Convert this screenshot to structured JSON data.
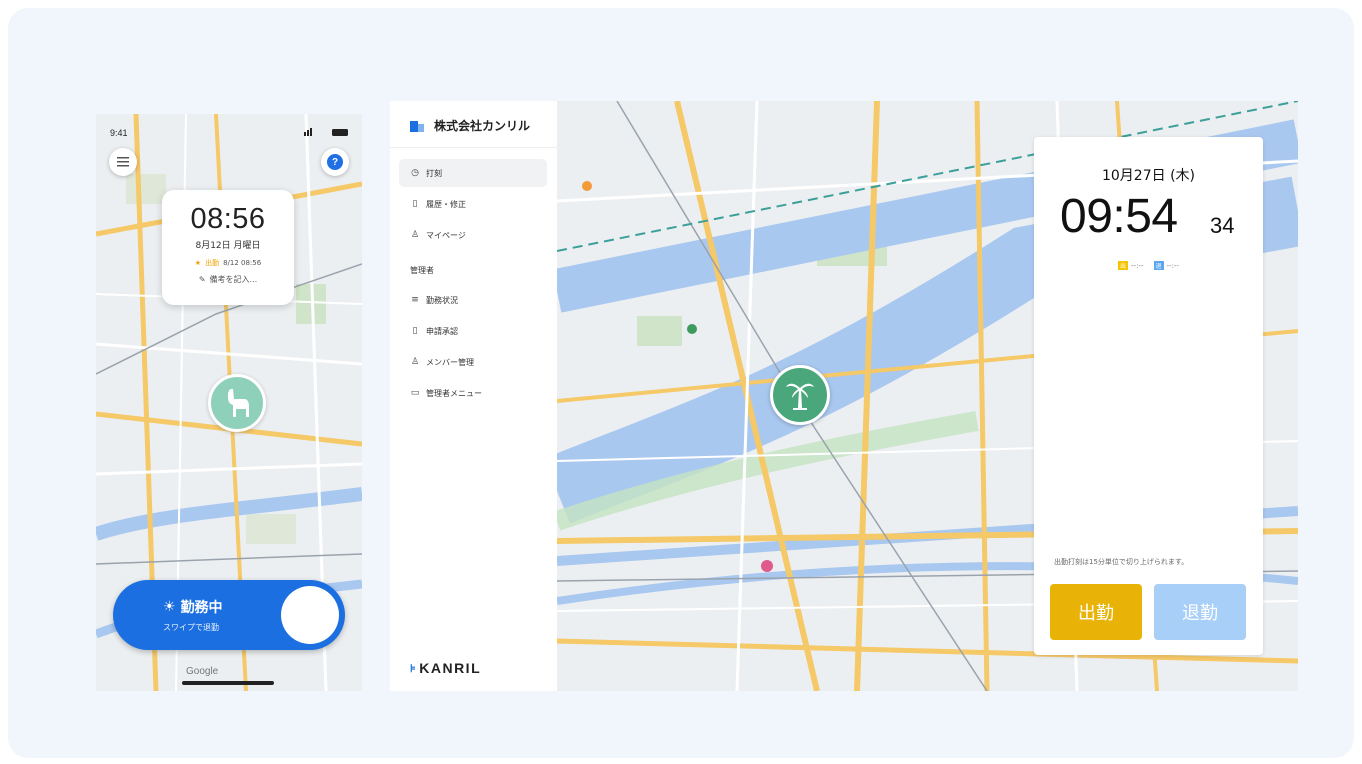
{
  "phone": {
    "status_time": "9:41",
    "clock": {
      "time": "08:56",
      "date": "8月12日 月曜日",
      "punch_label": "出勤",
      "punch_time": "8/12 08:56",
      "memo": "備考を記入..."
    },
    "swipe": {
      "status": "勤務中",
      "hint": "スワイプで退勤"
    },
    "google": "Google",
    "avatar_icon": "alpaca-icon"
  },
  "web": {
    "company": "株式会社カンリル",
    "nav": [
      {
        "label": "打刻",
        "icon": "clock-icon"
      },
      {
        "label": "履歴・修正",
        "icon": "document-icon"
      },
      {
        "label": "マイページ",
        "icon": "person-icon"
      }
    ],
    "admin_section": "管理者",
    "admin_nav": [
      {
        "label": "勤務状況",
        "icon": "list-icon"
      },
      {
        "label": "申請承認",
        "icon": "document-icon"
      },
      {
        "label": "メンバー管理",
        "icon": "people-icon"
      },
      {
        "label": "管理者メニュー",
        "icon": "tablet-icon"
      }
    ],
    "brand": "KANRIL"
  },
  "punch_panel": {
    "date": "10月27日 (木)",
    "time": "09:54",
    "seconds": "34",
    "in_badge": "出",
    "in_time": "--:--",
    "out_badge": "退",
    "out_time": "--:--",
    "note": "出勤打刻は15分単位で切り上げられます。",
    "clock_in": "出勤",
    "clock_out": "退勤"
  },
  "colors": {
    "background": "#f1f6fd",
    "primary_blue": "#1b6fe0",
    "clock_in_yellow": "#e9b207",
    "clock_out_light_blue": "#a7cff7",
    "pin_green": "#4aa77b",
    "avatar_mint": "#8fd0bb"
  }
}
